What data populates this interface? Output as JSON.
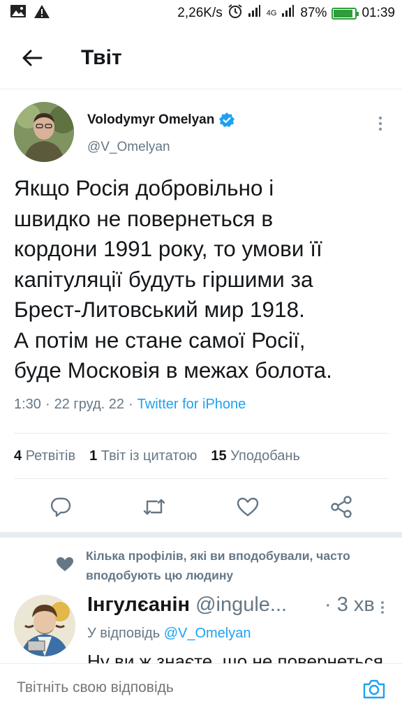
{
  "status_bar": {
    "speed": "2,26K/s",
    "network": "4G",
    "battery": "87%",
    "battery_level": 0.87,
    "time": "01:39"
  },
  "header": {
    "title": "Твіт"
  },
  "tweet": {
    "author_name": "Volodymyr Omelyan",
    "author_handle": "@V_Omelyan",
    "verified": true,
    "text_lines": [
      "Якщо Росія добровільно і",
      "швидко не повернеться в",
      "кордони 1991 року, то умови її",
      "капітуляції будуть гіршими за",
      "Брест-Литовський мир 1918.",
      "А потім не стане самої Росії,",
      "буде Московія в межах болота."
    ],
    "time": "1:30",
    "date": "22 груд. 22",
    "source": "Twitter for iPhone",
    "retweets_count": "4",
    "retweets_label": "Ретвітів",
    "quotes_count": "1",
    "quotes_label": "Твіт із цитатою",
    "likes_count": "15",
    "likes_label": "Уподобань"
  },
  "social_context": {
    "text": "Кілька профілів, які ви вподобували, часто вподобують цю людину"
  },
  "reply": {
    "name": "Інгулєанін",
    "handle": "@ingule...",
    "time": "· 3 хв",
    "reply_prefix": "У відповідь",
    "reply_to": "@V_Omelyan",
    "preview": "Ну ви ж знаєте, що не повернеться"
  },
  "composer": {
    "placeholder": "Твітніть свою відповідь"
  },
  "colors": {
    "accent": "#1da1f2",
    "text": "#14171a",
    "secondary": "#657786",
    "battery": "#2e9d3a"
  }
}
